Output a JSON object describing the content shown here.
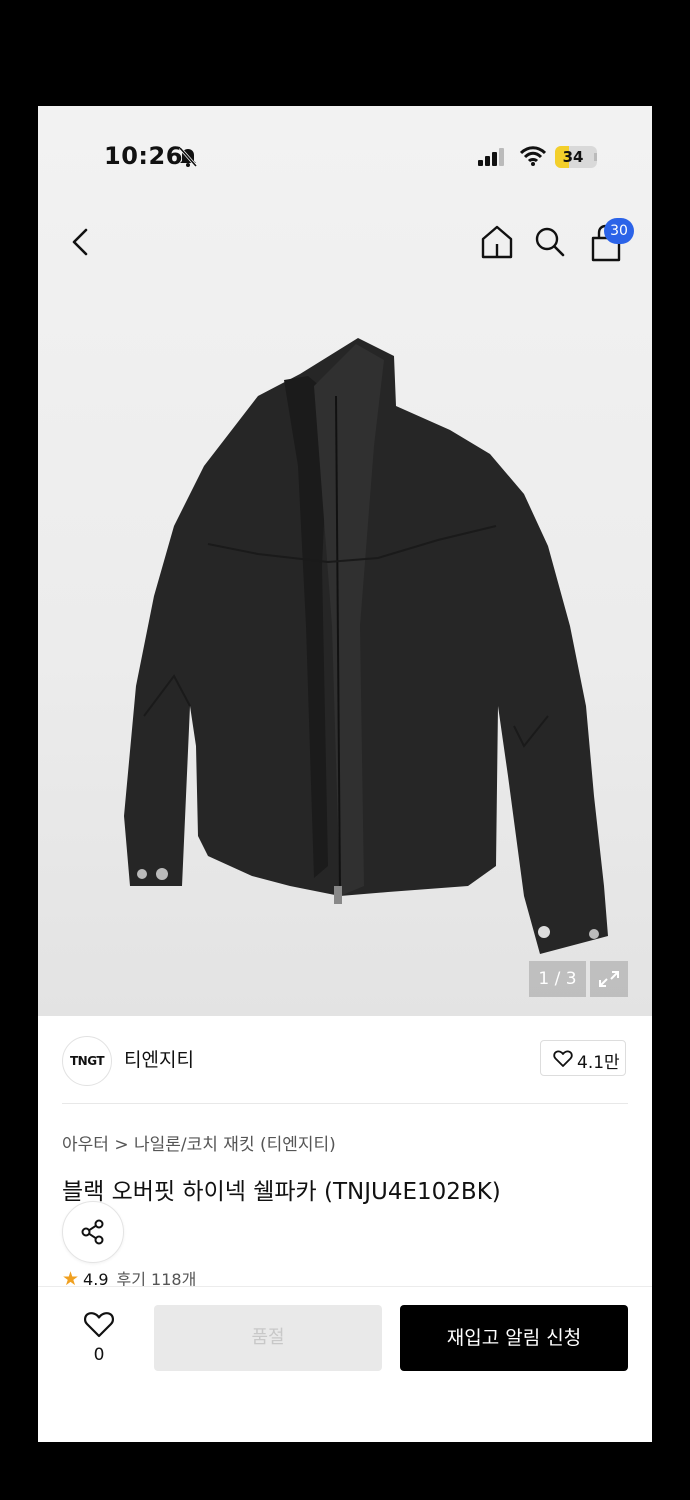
{
  "status_bar": {
    "time": "10:26",
    "battery": "34",
    "battery_level": 0.34
  },
  "header": {
    "cart_count": "30"
  },
  "gallery": {
    "counter": "1 / 3"
  },
  "brand": {
    "logo_text": "TNGT",
    "name": "티엔지티",
    "likes": "4.1만"
  },
  "product": {
    "breadcrumb": "아우터 > 나일론/코치 재킷 (티엔지티)",
    "title": "블랙 오버핏 하이넥 쉘파카 (TNJU4E102BK)",
    "rating": "4.9",
    "reviews": "후기 118개"
  },
  "bottom_bar": {
    "wish_count": "0",
    "soldout_label": "품절",
    "restock_label": "재입고 알림 신청"
  },
  "colors": {
    "accent_badge": "#2b63e8",
    "star": "#f0a020",
    "battery": "#f3cf2b",
    "primary_button": "#000000"
  },
  "icons": [
    "bell-off-icon",
    "signal-icon",
    "wifi-icon",
    "battery-icon",
    "back-icon",
    "home-icon",
    "search-icon",
    "shopping-bag-icon",
    "expand-icon",
    "heart-icon",
    "share-icon",
    "star-icon"
  ]
}
